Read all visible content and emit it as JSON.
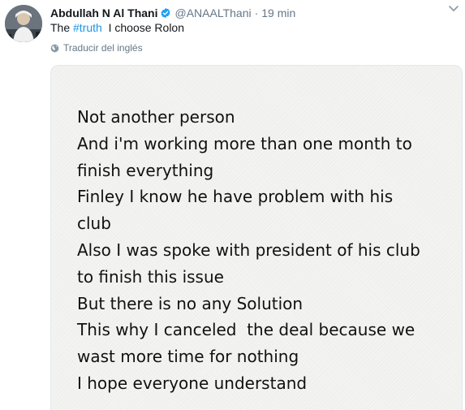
{
  "tweet": {
    "author": {
      "display_name": "Abdullah N Al Thani",
      "handle": "@ANAALThani",
      "verified": true,
      "avatar_icon": "profile-photo"
    },
    "separator": "·",
    "timestamp": "19 min",
    "text_prefix": "The ",
    "hashtag": "#truth",
    "text_suffix": "  I choose Rolon",
    "translate_label": "Traducir del inglés",
    "media": {
      "lines": [
        "Not another person",
        "And i'm working more than one month to",
        "finish everything",
        "Finley I know he have problem with his",
        "club",
        "Also I was spoke with president of his club",
        "to finish this issue",
        "But there is no any Solution",
        "This why I canceled  the deal because we",
        "wast more time for nothing",
        "I hope everyone understand"
      ]
    },
    "menu_icon": "chevron-down-icon"
  },
  "colors": {
    "text": "#14171a",
    "secondary": "#657786",
    "link": "#1b95e0",
    "verified": "#1da1f2",
    "note_background": "#f4f4f2"
  }
}
